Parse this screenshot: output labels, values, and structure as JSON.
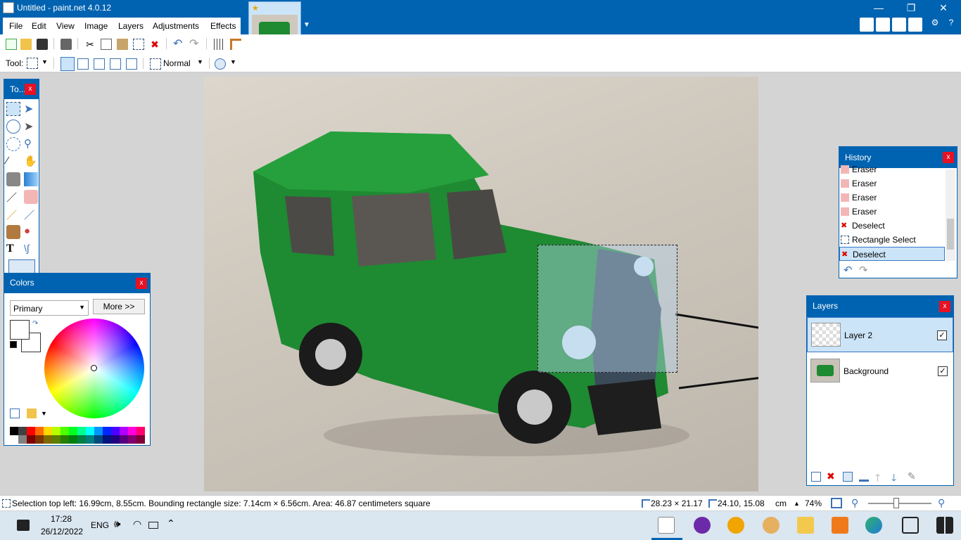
{
  "window": {
    "title": "Untitled - paint.net 4.0.12"
  },
  "menu": [
    "File",
    "Edit",
    "View",
    "Image",
    "Layers",
    "Adjustments",
    "Effects"
  ],
  "toolbar": {
    "tool_label": "Tool:",
    "blend_mode": "Normal"
  },
  "tools_panel": {
    "title": "To..."
  },
  "colors_panel": {
    "title": "Colors",
    "mode": "Primary",
    "more": "More >>"
  },
  "history_panel": {
    "title": "History",
    "items": [
      "Eraser",
      "Eraser",
      "Eraser",
      "Eraser",
      "Deselect",
      "Rectangle Select",
      "Deselect"
    ]
  },
  "layers_panel": {
    "title": "Layers",
    "layers": [
      {
        "name": "Layer 2",
        "visible": true,
        "selected": true
      },
      {
        "name": "Background",
        "visible": true,
        "selected": false
      }
    ]
  },
  "status": {
    "selection": "Selection top left: 16.99cm, 8.55cm. Bounding rectangle size: 7.14cm × 6.56cm. Area: 46.87 centimeters square",
    "size": "28.23 × 21.17",
    "cursor": "24.10, 15.08",
    "unit": "cm",
    "zoom": "74%"
  },
  "taskbar": {
    "time": "17:28",
    "date": "26/12/2022",
    "lang": "ENG"
  },
  "colors": {
    "accent": "#0063b1",
    "close": "#e81123",
    "car": "#1e8a32"
  }
}
